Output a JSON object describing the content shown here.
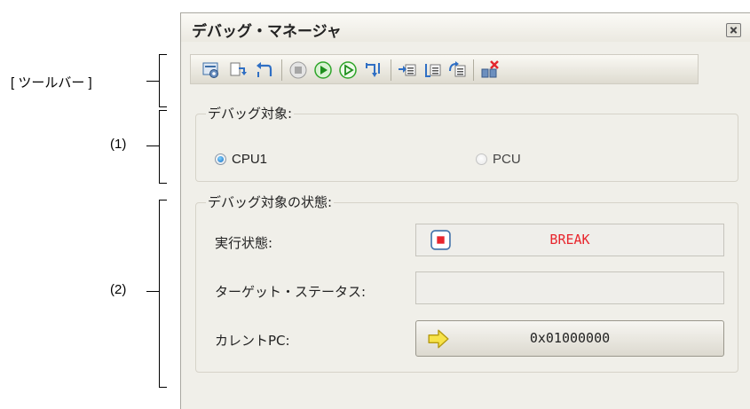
{
  "annotations": {
    "toolbar_label": "[ ツールバー ]",
    "section1_label": "(1)",
    "section2_label": "(2)"
  },
  "window": {
    "title": "デバッグ・マネージャ",
    "close_icon": "close-icon"
  },
  "toolbar": {
    "buttons": [
      {
        "name": "target-settings-icon"
      },
      {
        "name": "step-in-icon"
      },
      {
        "name": "return-out-icon"
      },
      {
        "name": "stop-icon"
      },
      {
        "name": "go-icon"
      },
      {
        "name": "ignore-break-go-icon"
      },
      {
        "name": "step-over-icon"
      },
      {
        "name": "cpu-go-icon"
      },
      {
        "name": "cpu-break-icon"
      },
      {
        "name": "cpu-reset-icon"
      },
      {
        "name": "disconnect-icon"
      }
    ]
  },
  "debug_target": {
    "group_title": "デバッグ対象:",
    "options": [
      {
        "label": "CPU1",
        "checked": true,
        "enabled": true
      },
      {
        "label": "PCU",
        "checked": false,
        "enabled": false
      }
    ]
  },
  "target_state": {
    "group_title": "デバッグ対象の状態:",
    "exec_state_label": "実行状態:",
    "exec_state_value": "BREAK",
    "exec_state_icon": "break-state-icon",
    "target_status_label": "ターゲット・ステータス:",
    "target_status_value": "",
    "current_pc_label": "カレントPC:",
    "current_pc_value": "0x01000000",
    "current_pc_icon": "arrow-right-icon"
  },
  "colors": {
    "break_text": "#e8262d",
    "accent_green": "#2fa52a",
    "accent_blue": "#2f6fc4"
  }
}
